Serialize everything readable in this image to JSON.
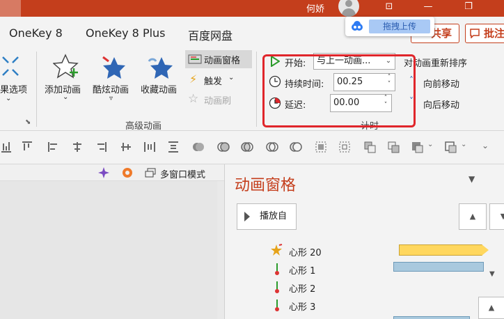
{
  "titlebar": {
    "user": "何娇",
    "ribbon_display_glyph": "⊡",
    "restore_glyph": "❐"
  },
  "tabs": [
    "OneKey 8",
    "OneKey 8 Plus",
    "百度网盘"
  ],
  "account": {
    "share": "共享",
    "comment": "批注"
  },
  "baidu_popup": {
    "upload": "拖拽上传"
  },
  "ribbon": {
    "effect_options": "果选项",
    "add_animation": "添加动画",
    "cool_animation": "酷炫动画",
    "favorite_animation": "收藏动画",
    "animation_pane": "动画窗格",
    "trigger": "触发",
    "animation_painter": "动画刷",
    "advanced_group": "高级动画",
    "start_label": "开始:",
    "start_value": "与上一动画...",
    "duration_label": "持续时间:",
    "duration_value": "00.25",
    "delay_label": "延迟:",
    "delay_value": "00.00",
    "timing_group": "计时",
    "reorder_label": "对动画重新排序",
    "move_earlier": "向前移动",
    "move_later": "向后移动"
  },
  "workspace": {
    "multi_window": "多窗口模式"
  },
  "pane": {
    "title": "动画窗格",
    "play_from": "播放自",
    "items": [
      "心形 20",
      "心形 1",
      "心形 2",
      "心形 3"
    ]
  },
  "colors": {
    "accent": "#c43e1c",
    "highlight": "#e0262b",
    "star": "#2f66b5"
  }
}
